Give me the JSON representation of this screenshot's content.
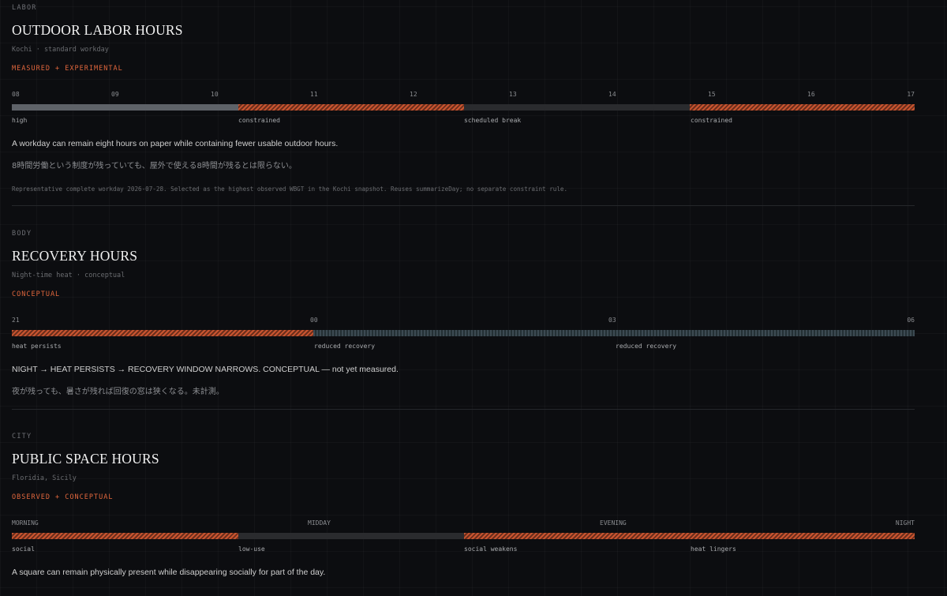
{
  "sections": [
    {
      "eyebrow": "LABOR",
      "title": "OUTDOOR LABOR HOURS",
      "subtitle": "Kochi · standard workday",
      "badge": "MEASURED + EXPERIMENTAL",
      "ticks": [
        "08",
        "09",
        "10",
        "11",
        "12",
        "13",
        "14",
        "15",
        "16",
        "17"
      ],
      "segments": [
        {
          "label": "high",
          "type": "high",
          "hours": 2.25
        },
        {
          "label": "constrained",
          "type": "hatch",
          "hours": 2.25
        },
        {
          "label": "scheduled break",
          "type": "dark",
          "hours": 2.25
        },
        {
          "label": "constrained",
          "type": "hatch",
          "hours": 2.25
        }
      ],
      "body_en": "A workday can remain eight hours on paper while containing fewer usable outdoor hours.",
      "body_ja": "8時間労働という制度が残っていても、屋外で使える8時間が残るとは限らない。",
      "note": "Representative complete workday 2026-07-28. Selected as the highest observed WBGT in the Kochi snapshot. Reuses summarizeDay; no separate constraint rule."
    },
    {
      "eyebrow": "BODY",
      "title": "RECOVERY HOURS",
      "subtitle": "Night-time heat · conceptual",
      "badge": "CONCEPTUAL",
      "ticks": [
        "21",
        "00",
        "03",
        "06"
      ],
      "segments": [
        {
          "label": "heat persists",
          "type": "hatch",
          "hours": 3
        },
        {
          "label": "reduced recovery",
          "type": "stripe",
          "hours": 3
        },
        {
          "label": "reduced recovery",
          "type": "stripe",
          "hours": 3
        }
      ],
      "body_en": "NIGHT → HEAT PERSISTS → RECOVERY WINDOW NARROWS. CONCEPTUAL — not yet measured.",
      "body_ja": "夜が残っても、暑さが残れば回復の窓は狭くなる。未計測。"
    },
    {
      "eyebrow": "CITY",
      "title": "PUBLIC SPACE HOURS",
      "subtitle": "Floridia, Sicily",
      "badge": "OBSERVED + CONCEPTUAL",
      "ticks": [
        "MORNING",
        "MIDDAY",
        "EVENING",
        "NIGHT"
      ],
      "segments": [
        {
          "label": "social",
          "type": "hatch",
          "hours": 1
        },
        {
          "label": "low-use",
          "type": "dark",
          "hours": 1
        },
        {
          "label": "social weakens",
          "type": "hatch",
          "hours": 1
        },
        {
          "label": "heat lingers",
          "type": "hatch",
          "hours": 1
        }
      ],
      "body_en": "A square can remain physically present while disappearing socially for part of the day."
    }
  ]
}
